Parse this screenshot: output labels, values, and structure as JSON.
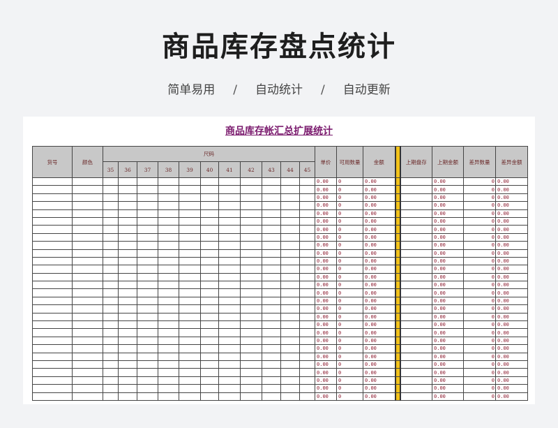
{
  "page": {
    "title": "商品库存盘点统计",
    "tags": [
      "简单易用",
      "自动统计",
      "自动更新"
    ],
    "separator": "/"
  },
  "sheet": {
    "title": "商品库存帐汇总扩展统计",
    "headers": {
      "item_no": "货号",
      "color": "颜色",
      "size": "尺码",
      "sizes": [
        "35",
        "36",
        "37",
        "38",
        "39",
        "40",
        "41",
        "42",
        "43",
        "44",
        "45"
      ],
      "unit_price": "单价",
      "available_qty": "可用数量",
      "amount": "金额",
      "last_stock": "上期盘存",
      "last_amount": "上期金额",
      "diff_qty": "差异数量",
      "diff_amount": "差异金额"
    },
    "row_defaults": {
      "unit_price": "0.00",
      "available_qty": "0",
      "amount": "0.00",
      "last_amount": "0.00",
      "diff_qty": "0",
      "diff_amount": "0.00"
    },
    "row_count": 28
  },
  "colors": {
    "title_text": "#7b1b6e",
    "header_bg": "#c8c8c8",
    "value_text": "#8c1a2e",
    "divider": "#f2c21a"
  }
}
